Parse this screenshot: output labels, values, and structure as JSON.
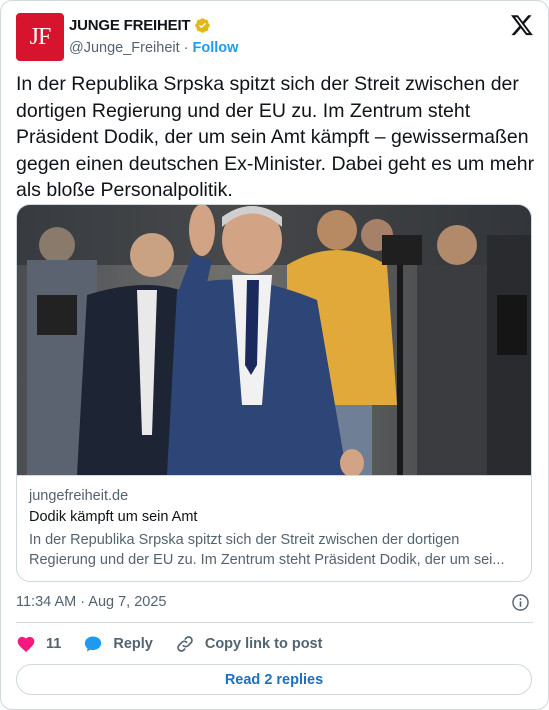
{
  "account": {
    "avatar_text": "JF",
    "name": "JUNGE FREIHEIT",
    "handle": "@Junge_Freiheit",
    "separator": "·",
    "follow_label": "Follow",
    "verified_badge_color": "#e2b719",
    "brand_color": "#d6142e"
  },
  "platform_icon": "x-logo-icon",
  "tweet": {
    "text": "In der Republika Srpska spitzt sich der Streit zwischen der dortigen Regierung und der EU zu. Im Zentrum steht Präsident Dodik, der um sein Amt kämpft – gewissermaßen gegen einen deutschen Ex-Minister. Dabei geht es um mehr als bloße Personalpolitik."
  },
  "link_card": {
    "domain": "jungefreiheit.de",
    "title": "Dodik kämpft um sein Amt",
    "description": "In der Republika Srpska spitzt sich der Streit zwischen der dortigen Regierung und der EU zu. Im Zentrum steht Präsident Dodik, der um sei..."
  },
  "meta": {
    "timestamp": "11:34 AM · Aug 7, 2025"
  },
  "actions": {
    "like_count": "11",
    "reply_label": "Reply",
    "copy_label": "Copy link to post",
    "like_color": "#f91880",
    "reply_color": "#1d9bf0"
  },
  "read_replies_label": "Read 2 replies"
}
